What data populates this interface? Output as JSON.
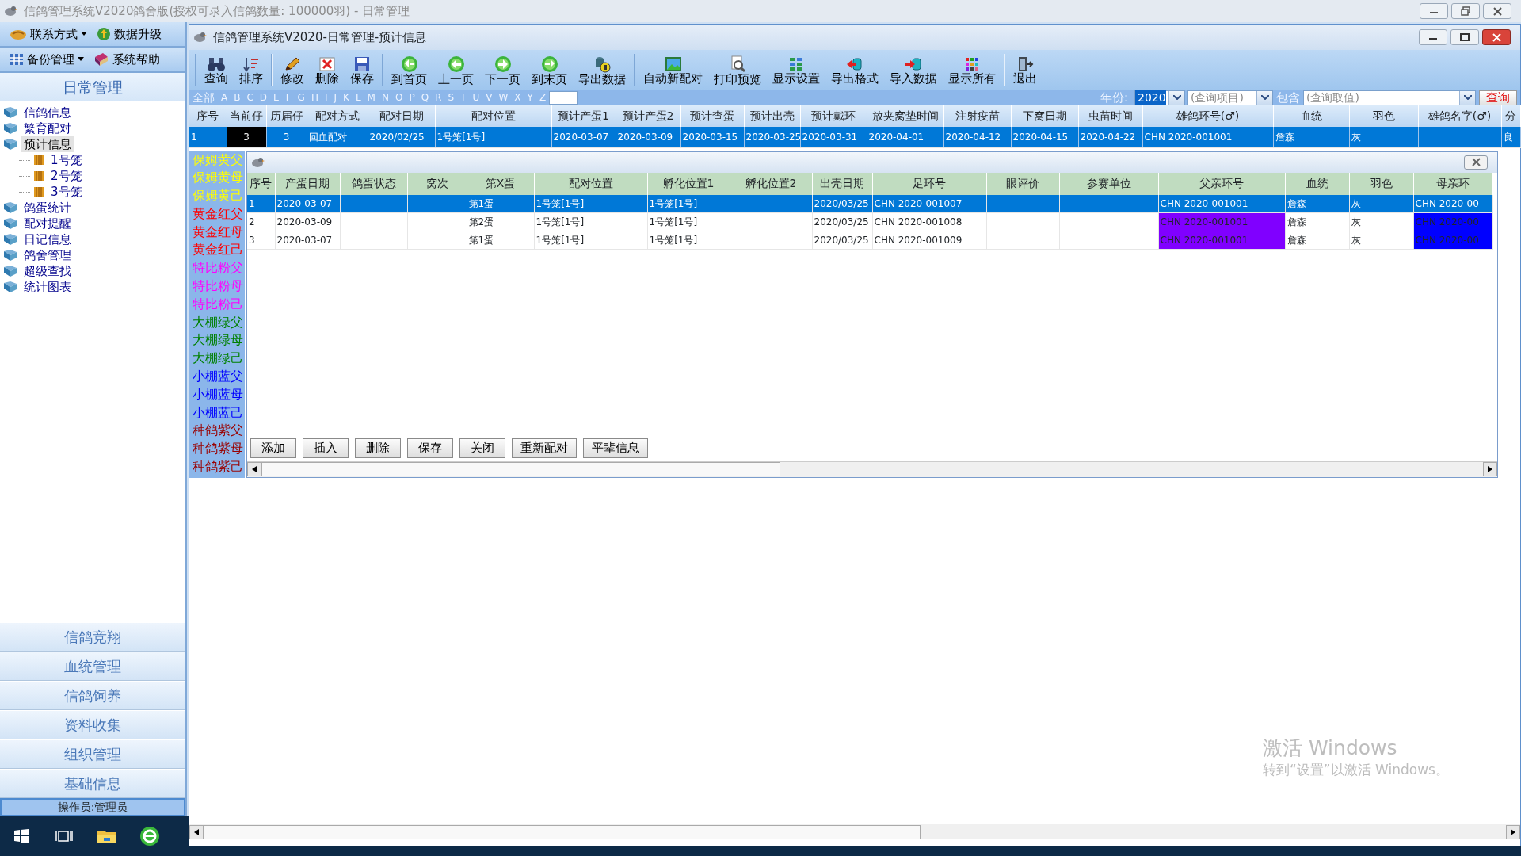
{
  "app": {
    "title": "信鸽管理系统V2020鸽舍版(授权可录入信鸽数量: 100000羽) - 日常管理"
  },
  "sidebar": {
    "toolbar_rows": [
      [
        {
          "label": "联系方式",
          "dropdown": true
        },
        {
          "label": "数据升级",
          "dropdown": false
        }
      ],
      [
        {
          "label": "备份管理",
          "dropdown": true
        },
        {
          "label": "系统帮助",
          "dropdown": false
        }
      ]
    ],
    "section_title": "日常管理",
    "tree": [
      {
        "label": "信鸽信息",
        "selected": false
      },
      {
        "label": "繁育配对",
        "selected": false
      },
      {
        "label": "预计信息",
        "selected": true,
        "children": [
          {
            "label": "1号笼",
            "selected": false
          },
          {
            "label": "2号笼",
            "selected": false
          },
          {
            "label": "3号笼",
            "selected": false
          }
        ]
      },
      {
        "label": "鸽蛋统计",
        "selected": false
      },
      {
        "label": "配对提醒",
        "selected": false
      },
      {
        "label": "日记信息",
        "selected": false
      },
      {
        "label": "鸽舍管理",
        "selected": false
      },
      {
        "label": "超级查找",
        "selected": false
      },
      {
        "label": "统计图表",
        "selected": false
      }
    ],
    "nav_buttons": [
      "信鸽竞翔",
      "血统管理",
      "信鸽饲养",
      "资料收集",
      "组织管理",
      "基础信息"
    ],
    "operator": "操作员:管理员"
  },
  "window": {
    "title": "信鸽管理系统V2020-日常管理-预计信息"
  },
  "toolbar": [
    [
      "查询",
      "排序"
    ],
    [
      "修改",
      "删除",
      "保存"
    ],
    [
      "到首页",
      "上一页",
      "下一页",
      "到末页",
      "导出数据"
    ],
    [
      "自动新配对",
      "打印预览",
      "显示设置",
      "导出格式",
      "导入数据",
      "显示所有"
    ],
    [
      "退出"
    ]
  ],
  "filter": {
    "letters": [
      "全部",
      "A",
      "B",
      "C",
      "D",
      "E",
      "F",
      "G",
      "H",
      "I",
      "J",
      "K",
      "L",
      "M",
      "N",
      "O",
      "P",
      "Q",
      "R",
      "S",
      "T",
      "U",
      "V",
      "W",
      "X",
      "Y",
      "Z"
    ],
    "year_label": "年份:",
    "year": "2020",
    "query_field": "(查询项目)",
    "match_label": "包含",
    "query_value": "(查询取值)",
    "search_button": "查询"
  },
  "pairs_table": {
    "columns": [
      "序号",
      "当前仔",
      "历届仔",
      "配对方式",
      "配对日期",
      "配对位置",
      "预计产蛋1",
      "预计产蛋2",
      "预计查蛋",
      "预计出壳",
      "预计戴环",
      "放夹窝垫时间",
      "注射疫苗",
      "下窝日期",
      "虫苗时间",
      "雄鸽环号(♂)",
      "血统",
      "羽色",
      "雄鸽名字(♂)",
      "分"
    ],
    "rows": [
      {
        "selected": true,
        "cells": [
          "1",
          {
            "text": "3",
            "focused": true
          },
          "3",
          "回血配对",
          "2020/02/25",
          "1号笼[1号]",
          "2020-03-07",
          "2020-03-09",
          "2020-03-15",
          "2020-03-25",
          "2020-03-31",
          "2020-04-01",
          "2020-04-12",
          "2020-04-15",
          "2020-04-22",
          "CHN 2020-001001",
          "詹森",
          "灰",
          null,
          "良"
        ]
      }
    ]
  },
  "color_legend": [
    {
      "label": "保姆黄父",
      "color": "#ffff00"
    },
    {
      "label": "保姆黄母",
      "color": "#ffff00"
    },
    {
      "label": "保姆黄己",
      "color": "#ffff00"
    },
    {
      "label": "黄金红父",
      "color": "#ff0000"
    },
    {
      "label": "黄金红母",
      "color": "#ff0000"
    },
    {
      "label": "黄金红己",
      "color": "#ff0000"
    },
    {
      "label": "特比粉父",
      "color": "#ff00ff"
    },
    {
      "label": "特比粉母",
      "color": "#ff00ff"
    },
    {
      "label": "特比粉己",
      "color": "#ff00ff"
    },
    {
      "label": "大棚绿父",
      "color": "#008000"
    },
    {
      "label": "大棚绿母",
      "color": "#008000"
    },
    {
      "label": "大棚绿己",
      "color": "#008000"
    },
    {
      "label": "小棚蓝父",
      "color": "#0000ff"
    },
    {
      "label": "小棚蓝母",
      "color": "#0000ff"
    },
    {
      "label": "小棚蓝己",
      "color": "#0000ff"
    },
    {
      "label": "种鸽紫父",
      "color": "#990000"
    },
    {
      "label": "种鸽紫母",
      "color": "#990000"
    },
    {
      "label": "种鸽紫己",
      "color": "#990000"
    }
  ],
  "eggs_panel": {
    "columns": [
      "序号",
      "产蛋日期",
      "鸽蛋状态",
      "窝次",
      "第X蛋",
      "配对位置",
      "孵化位置1",
      "孵化位置2",
      "出壳日期",
      "足环号",
      "眼评价",
      "参赛单位",
      "父亲环号",
      "血统",
      "羽色",
      "母亲环"
    ],
    "rows": [
      {
        "selected": true,
        "cells": [
          "1",
          "2020-03-07",
          null,
          null,
          "第1蛋",
          "1号笼[1号]",
          "1号笼[1号]",
          null,
          "2020/03/25",
          "CHN 2020-001007",
          null,
          null,
          "CHN 2020-001001",
          "詹森",
          "灰",
          "CHN 2020-00"
        ]
      },
      {
        "selected": false,
        "cells": [
          "2",
          "2020-03-09",
          null,
          null,
          "第2蛋",
          "1号笼[1号]",
          "1号笼[1号]",
          null,
          "2020/03/25",
          "CHN 2020-001008",
          null,
          null,
          {
            "text": "CHN 2020-001001",
            "color": "#8000ff"
          },
          "詹森",
          "灰",
          {
            "text": "CHN 2020-00",
            "color": "#0000ff"
          }
        ]
      },
      {
        "selected": false,
        "cells": [
          "3",
          "2020-03-07",
          null,
          null,
          "第1蛋",
          "1号笼[1号]",
          "1号笼[1号]",
          null,
          "2020/03/25",
          "CHN 2020-001009",
          null,
          null,
          {
            "text": "CHN 2020-001001",
            "color": "#8000ff"
          },
          "詹森",
          "灰",
          {
            "text": "CHN 2020-00",
            "color": "#0000ff"
          }
        ]
      }
    ],
    "buttons": [
      "添加",
      "插入",
      "删除",
      "保存",
      "关闭",
      "重新配对",
      "平辈信息"
    ]
  },
  "activation_notice": {
    "title": "激活 Windows",
    "text": "转到“设置”以激活 Windows。"
  }
}
